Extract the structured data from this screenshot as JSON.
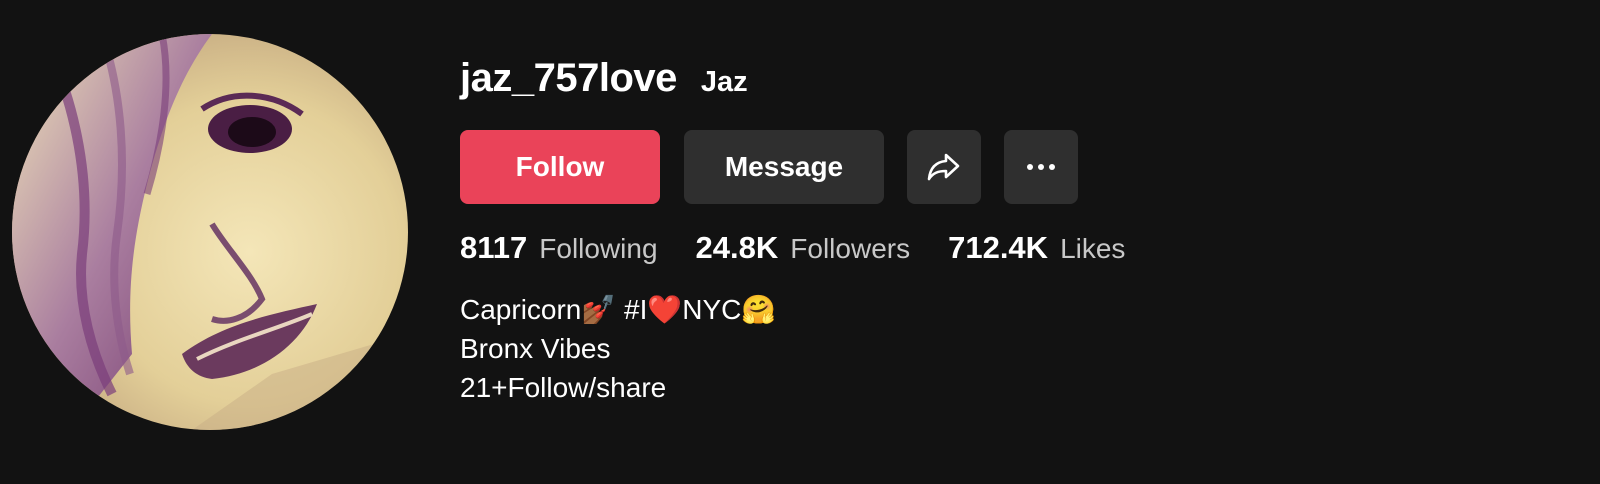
{
  "profile": {
    "username": "jaz_757love",
    "nickname": "Jaz",
    "avatar_alt": "profile-photo"
  },
  "actions": {
    "follow_label": "Follow",
    "message_label": "Message",
    "share_icon": "share-arrow-icon",
    "more_icon": "more-dots-icon"
  },
  "stats": {
    "following_count": "8117",
    "following_label": "Following",
    "followers_count": "24.8K",
    "followers_label": "Followers",
    "likes_count": "712.4K",
    "likes_label": "Likes"
  },
  "bio": {
    "lines": [
      "Capricorn💅🏾 #I❤️NYC🤗",
      "Bronx Vibes",
      "21+Follow/share"
    ]
  },
  "colors": {
    "background": "#121212",
    "follow": "#ea4359",
    "secondary_button": "#2f2f2f",
    "muted_text": "#c8c8c8"
  }
}
